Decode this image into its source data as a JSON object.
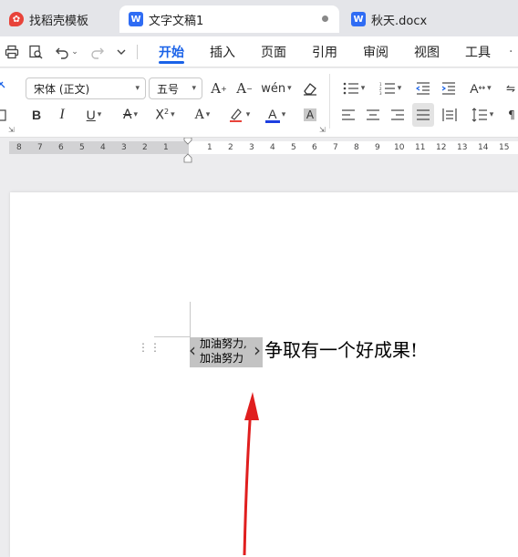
{
  "tabs": [
    {
      "label": "找稻壳模板",
      "logo": "W"
    },
    {
      "label": "文字文稿1",
      "logo": "W"
    },
    {
      "label": "秋天.docx",
      "logo": "W"
    }
  ],
  "menu": {
    "items": [
      "开始",
      "插入",
      "页面",
      "引用",
      "审阅",
      "视图",
      "工具"
    ],
    "active": "开始"
  },
  "ribbon": {
    "font_name": "宋体 (正文)",
    "font_size": "五号",
    "buttons_row1": [
      "A⁺",
      "A⁻",
      "wen",
      "eraser"
    ],
    "buttons_row2": [
      "B",
      "I",
      "U",
      "A"
    ]
  },
  "ruler": {
    "left_numbers": [
      "8",
      "7",
      "6",
      "5",
      "4",
      "3",
      "2",
      "1"
    ],
    "right_numbers": [
      "1",
      "2",
      "3",
      "4",
      "5",
      "6",
      "7",
      "8",
      "9",
      "10",
      "11",
      "12",
      "13",
      "14",
      "15"
    ]
  },
  "document": {
    "combine_top": "加油努力,",
    "combine_bottom": "加油努力",
    "main_text": "争取有一个好成果!"
  },
  "colors": {
    "accent": "#1a62e8",
    "arrow": "#e01e1e",
    "font_color_bar": "#1d3ee0"
  }
}
